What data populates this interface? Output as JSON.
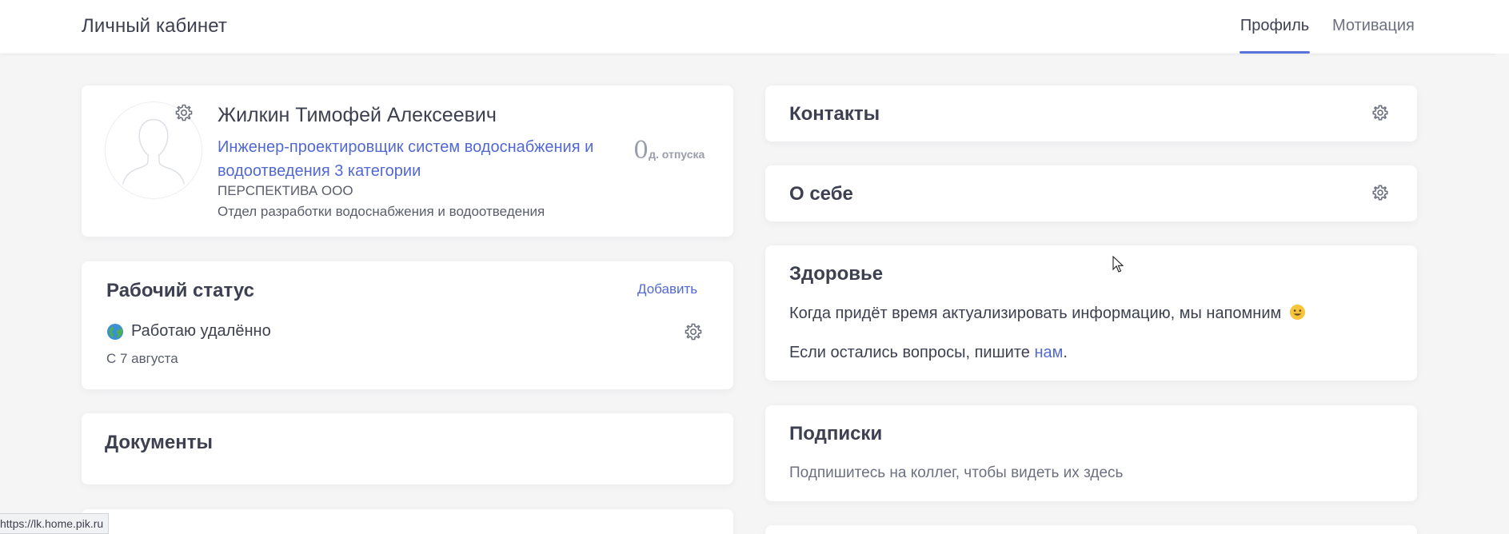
{
  "header": {
    "title": "Личный кабинет",
    "tabs": [
      {
        "label": "Профиль",
        "active": true
      },
      {
        "label": "Мотивация",
        "active": false
      }
    ]
  },
  "profile": {
    "name": "Жилкин Тимофей Алексеевич",
    "position": "Инженер-проектировщик систем водоснабжения и водоотведения 3 категории",
    "company": "ПЕРСПЕКТИВА ООО",
    "department": "Отдел разработки водоснабжения и водоотведения",
    "vacation_days": "0",
    "vacation_unit": "д. отпуска"
  },
  "work_status": {
    "title": "Рабочий статус",
    "add_label": "Добавить",
    "status": "Работаю удалённо",
    "since": "С 7 августа"
  },
  "documents": {
    "title": "Документы"
  },
  "contacts": {
    "title": "Контакты"
  },
  "about": {
    "title": "О себе"
  },
  "health": {
    "title": "Здоровье",
    "reminder": "Когда придёт время актуализировать информацию, мы напомним",
    "questions_prefix": "Если остались вопросы, пишите ",
    "questions_link": "нам",
    "questions_suffix": "."
  },
  "subscriptions": {
    "title": "Подписки",
    "empty_text": "Подпишитесь на коллег, чтобы видеть их здесь"
  },
  "browser_status": {
    "url": "https://lk.home.pik.ru"
  },
  "colors": {
    "accent": "#5268d3",
    "text": "#3d4050",
    "background": "#f5f5f6"
  },
  "icons": [
    "gear-icon",
    "avatar-placeholder-icon",
    "globe-icon",
    "smile-emoji-icon",
    "mouse-cursor-icon"
  ]
}
